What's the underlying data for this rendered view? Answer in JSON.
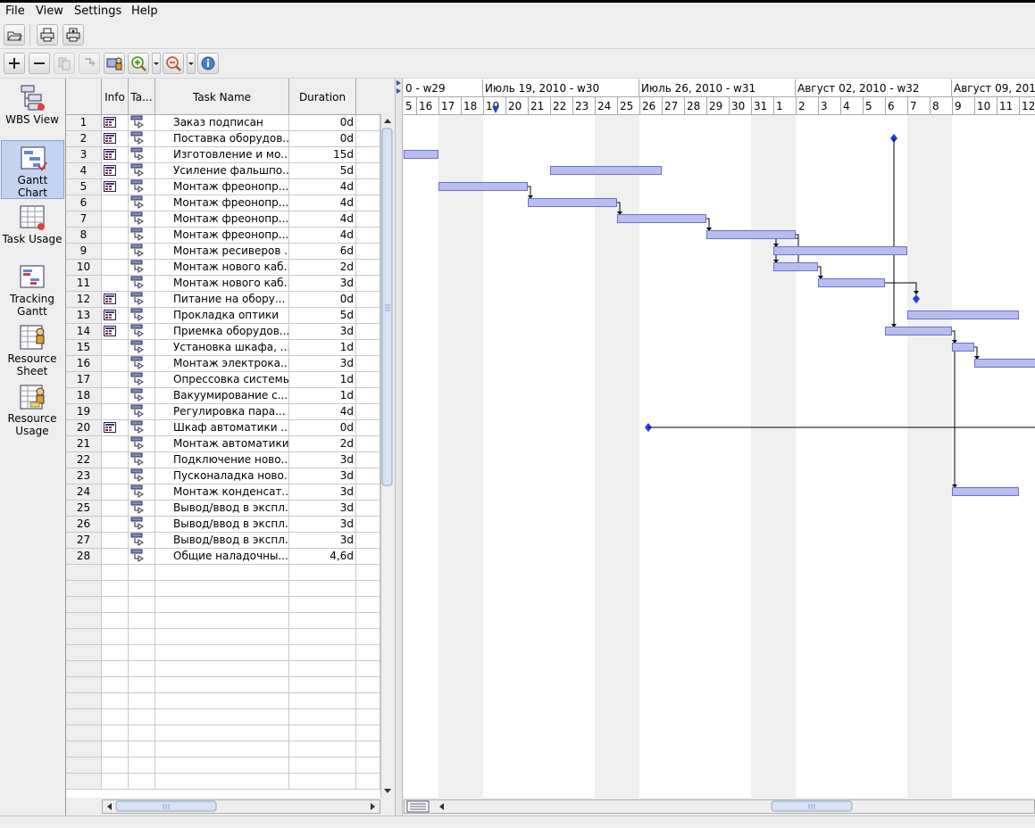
{
  "menu": [
    "File",
    "View",
    "Settings",
    "Help"
  ],
  "sidebar": [
    {
      "label": "WBS View",
      "icon": "wbs-view-icon"
    },
    {
      "label": "Gantt Chart",
      "icon": "gantt-chart-icon",
      "active": true
    },
    {
      "label": "Task Usage",
      "icon": "task-usage-icon"
    },
    {
      "label": "Tracking Gantt",
      "icon": "tracking-gantt-icon"
    },
    {
      "label": "Resource Sheet",
      "icon": "resource-sheet-icon"
    },
    {
      "label": "Resource Usage",
      "icon": "resource-usage-icon"
    }
  ],
  "columns": {
    "info": "Info",
    "type": "Ta...",
    "name": "Task Name",
    "duration": "Duration"
  },
  "tasks": [
    {
      "id": "1",
      "info": true,
      "name": "Заказ подписан",
      "duration": "0d"
    },
    {
      "id": "2",
      "info": true,
      "name": "Поставка оборудов...",
      "duration": "0d"
    },
    {
      "id": "3",
      "info": true,
      "name": "Изготовление и мо...",
      "duration": "15d"
    },
    {
      "id": "4",
      "info": true,
      "name": "Усиление фальшпо...",
      "duration": "5d"
    },
    {
      "id": "5",
      "info": true,
      "name": "Монтаж фреонопр...",
      "duration": "4d"
    },
    {
      "id": "6",
      "info": false,
      "name": "Монтаж фреонопр...",
      "duration": "4d"
    },
    {
      "id": "7",
      "info": false,
      "name": "Монтаж фреонопр...",
      "duration": "4d"
    },
    {
      "id": "8",
      "info": false,
      "name": "Монтаж фреонопр...",
      "duration": "4d"
    },
    {
      "id": "9",
      "info": false,
      "name": "Монтаж ресиверов ...",
      "duration": "6d"
    },
    {
      "id": "10",
      "info": false,
      "name": "Монтаж нового каб...",
      "duration": "2d"
    },
    {
      "id": "11",
      "info": false,
      "name": "Монтаж нового каб...",
      "duration": "3d"
    },
    {
      "id": "12",
      "info": true,
      "name": "Питание на обору...",
      "duration": "0d"
    },
    {
      "id": "13",
      "info": true,
      "name": "Прокладка оптики",
      "duration": "5d"
    },
    {
      "id": "14",
      "info": true,
      "name": "Приемка оборудов...",
      "duration": "3d"
    },
    {
      "id": "15",
      "info": false,
      "name": "Установка шкафа, ...",
      "duration": "1d"
    },
    {
      "id": "16",
      "info": false,
      "name": "Монтаж электрока...",
      "duration": "3d"
    },
    {
      "id": "17",
      "info": false,
      "name": "Опрессовка системы",
      "duration": "1d"
    },
    {
      "id": "18",
      "info": false,
      "name": "Вакуумирование с...",
      "duration": "1d"
    },
    {
      "id": "19",
      "info": false,
      "name": "Регулировка пара...",
      "duration": "4d"
    },
    {
      "id": "20",
      "info": true,
      "name": "Шкаф автоматики ...",
      "duration": "0d"
    },
    {
      "id": "21",
      "info": false,
      "name": "Монтаж автоматики",
      "duration": "2d"
    },
    {
      "id": "22",
      "info": false,
      "name": "Подключение ново...",
      "duration": "3d"
    },
    {
      "id": "23",
      "info": false,
      "name": "Пусконаладка ново...",
      "duration": "3d"
    },
    {
      "id": "24",
      "info": false,
      "name": "Монтаж конденсат...",
      "duration": "3d"
    },
    {
      "id": "25",
      "info": false,
      "name": "Вывод/ввод в экспл...",
      "duration": "3d"
    },
    {
      "id": "26",
      "info": false,
      "name": "Вывод/ввод в экспл...",
      "duration": "3d"
    },
    {
      "id": "27",
      "info": false,
      "name": "Вывод/ввод в экспл...",
      "duration": "3d"
    },
    {
      "id": "28",
      "info": false,
      "name": "Общие наладочны...",
      "duration": "4,6d"
    }
  ],
  "timeline": {
    "weeks": [
      "0 - w29",
      "Июль 19, 2010 - w30",
      "Июль 26, 2010 - w31",
      "Август 02, 2010 - w32",
      "Август 09, 2010"
    ],
    "days": [
      "5",
      "16",
      "17",
      "18",
      "19",
      "20",
      "21",
      "22",
      "23",
      "24",
      "25",
      "26",
      "27",
      "28",
      "29",
      "30",
      "31",
      "1",
      "2",
      "3",
      "4",
      "5",
      "6",
      "7",
      "8",
      "9",
      "10",
      "11",
      "12"
    ],
    "today_marker_day": "20"
  },
  "gantt": {
    "bars": [
      {
        "row": 3,
        "start": "16 Jul",
        "end": "17 Jul"
      },
      {
        "row": 4,
        "start": "22 Jul",
        "end": "27 Jul"
      },
      {
        "row": 5,
        "start": "17 Jul",
        "end": "21 Jul"
      },
      {
        "row": 6,
        "start": "21 Jul",
        "end": "25 Jul"
      },
      {
        "row": 7,
        "start": "25 Jul",
        "end": "29 Jul"
      },
      {
        "row": 8,
        "start": "29 Jul",
        "end": "2 Aug"
      },
      {
        "row": 9,
        "start": "1 Aug",
        "end": "7 Aug"
      },
      {
        "row": 10,
        "start": "1 Aug",
        "end": "3 Aug"
      },
      {
        "row": 11,
        "start": "3 Aug",
        "end": "6 Aug"
      },
      {
        "row": 13,
        "start": "7 Aug",
        "end": "12 Aug"
      },
      {
        "row": 14,
        "start": "6 Aug",
        "end": "9 Aug"
      },
      {
        "row": 15,
        "start": "9 Aug",
        "end": "10 Aug"
      },
      {
        "row": 16,
        "start": "10 Aug",
        "end": "13 Aug"
      },
      {
        "row": 24,
        "start": "9 Aug",
        "end": "12 Aug"
      }
    ],
    "milestones": [
      {
        "row": 2,
        "day": "6 Aug"
      },
      {
        "row": 12,
        "day": "7 Aug"
      },
      {
        "row": 20,
        "day": "26 Jul"
      }
    ]
  }
}
